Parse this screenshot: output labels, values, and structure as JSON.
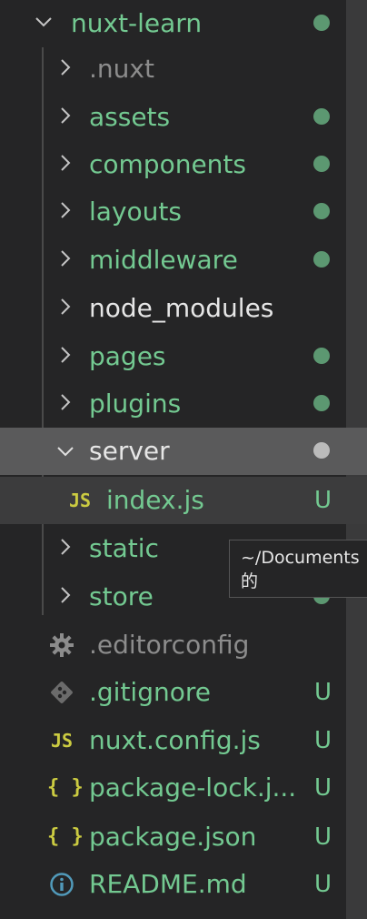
{
  "tree": {
    "root": {
      "label": "nuxt-learn",
      "status": "dot"
    },
    "items": [
      {
        "label": ".nuxt",
        "type": "folder",
        "expanded": false,
        "status": ""
      },
      {
        "label": "assets",
        "type": "folder",
        "expanded": false,
        "status": "dot"
      },
      {
        "label": "components",
        "type": "folder",
        "expanded": false,
        "status": "dot"
      },
      {
        "label": "layouts",
        "type": "folder",
        "expanded": false,
        "status": "dot"
      },
      {
        "label": "middleware",
        "type": "folder",
        "expanded": false,
        "status": "dot"
      },
      {
        "label": "node_modules",
        "type": "folder",
        "expanded": false,
        "status": ""
      },
      {
        "label": "pages",
        "type": "folder",
        "expanded": false,
        "status": "dot"
      },
      {
        "label": "plugins",
        "type": "folder",
        "expanded": false,
        "status": "dot"
      },
      {
        "label": "server",
        "type": "folder",
        "expanded": true,
        "status": "dot"
      },
      {
        "label": "index.js",
        "type": "file",
        "icon": "JS",
        "status": "U"
      },
      {
        "label": "static",
        "type": "folder",
        "expanded": false,
        "status": "dot"
      },
      {
        "label": "store",
        "type": "folder",
        "expanded": false,
        "status": "dot"
      },
      {
        "label": ".editorconfig",
        "type": "file",
        "icon": "gear-icon",
        "status": ""
      },
      {
        "label": ".gitignore",
        "type": "file",
        "icon": "git-icon",
        "status": "U"
      },
      {
        "label": "nuxt.config.js",
        "type": "file",
        "icon": "JS",
        "status": "U"
      },
      {
        "label": "package-lock.j...",
        "type": "file",
        "icon": "{ }",
        "status": "U"
      },
      {
        "label": "package.json",
        "type": "file",
        "icon": "{ }",
        "status": "U"
      },
      {
        "label": "README.md",
        "type": "file",
        "icon": "info-icon",
        "status": "U"
      }
    ]
  },
  "tooltip": {
    "line1": "~/Documents",
    "line2": "的"
  },
  "icons": {
    "js_glyph": "JS",
    "json_glyph": "{ }"
  },
  "colors": {
    "background": "#252526",
    "git_untracked": "#73c991",
    "selected_row": "#5a5a5b",
    "js_icon": "#cbcb41"
  }
}
